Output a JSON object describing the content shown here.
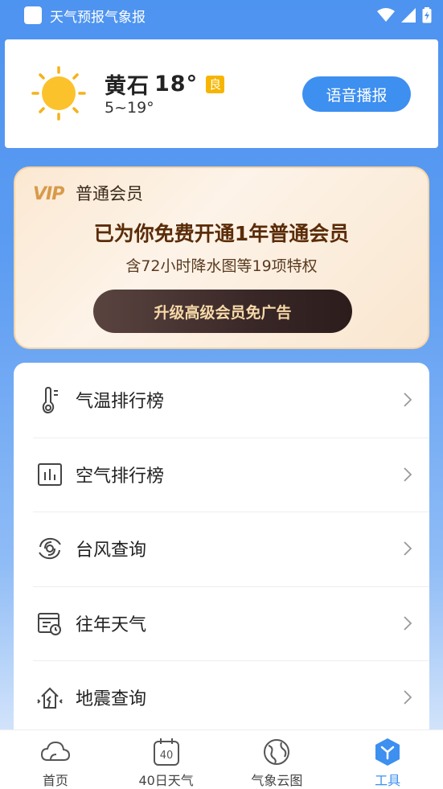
{
  "status_bar": {
    "app_title": "天气预报气象报"
  },
  "weather": {
    "city": "黄石",
    "temperature": "18°",
    "aqi": "良",
    "range": "5~19°",
    "voice_button": "语音播报"
  },
  "vip": {
    "logo": "VIP",
    "level": "普通会员",
    "title": "已为你免费开通1年普通会员",
    "subtitle": "含72小时降水图等19项特权",
    "upgrade_button": "升级高级会员免广告"
  },
  "tools": {
    "items": [
      {
        "label": "气温排行榜",
        "icon": "thermometer-icon"
      },
      {
        "label": "空气排行榜",
        "icon": "bar-chart-icon"
      },
      {
        "label": "台风查询",
        "icon": "typhoon-icon"
      },
      {
        "label": "往年天气",
        "icon": "calendar-clock-icon"
      },
      {
        "label": "地震查询",
        "icon": "earthquake-house-icon"
      }
    ]
  },
  "bottom_nav": {
    "items": [
      {
        "label": "首页",
        "icon": "cloud-icon",
        "active": false
      },
      {
        "label": "40日天气",
        "icon": "calendar-40-icon",
        "badge": "40",
        "active": false
      },
      {
        "label": "气象云图",
        "icon": "globe-icon",
        "active": false
      },
      {
        "label": "工具",
        "icon": "tools-hex-icon",
        "active": true
      }
    ]
  },
  "colors": {
    "accent": "#3d8ff0",
    "aqi_badge": "#f6b500",
    "vip_text": "#5a2c08"
  }
}
